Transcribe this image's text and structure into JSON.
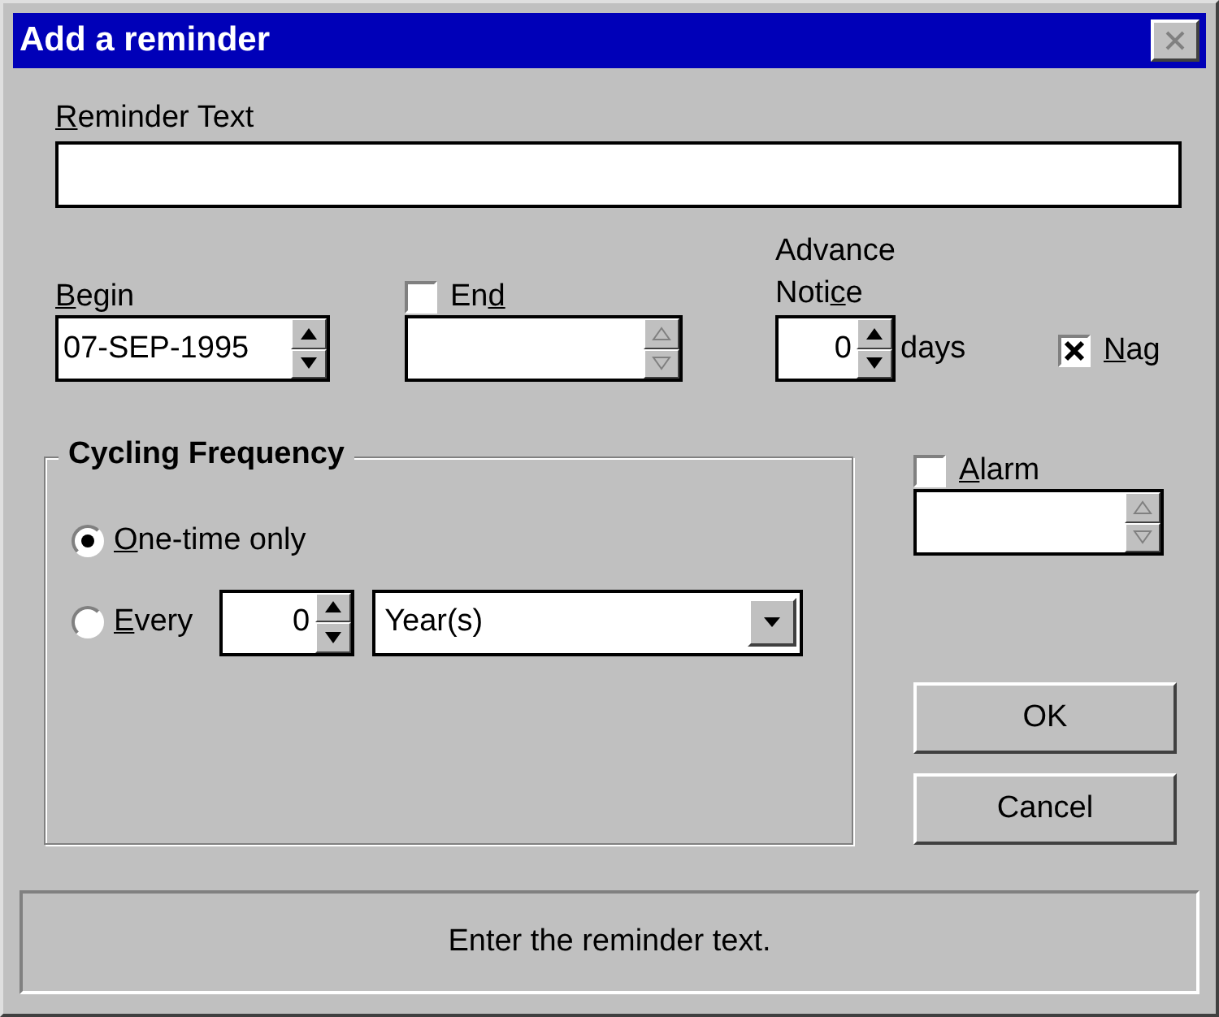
{
  "window": {
    "title": "Add a reminder"
  },
  "reminder_text": {
    "label": {
      "key": "R",
      "rest": "eminder Text"
    }
  },
  "begin": {
    "label": {
      "key": "B",
      "rest": "egin"
    },
    "value": "07-SEP-1995",
    "disabled": false
  },
  "end": {
    "label": {
      "lead": "En",
      "key": "d"
    },
    "checked": false,
    "disabled": true
  },
  "advance_notice": {
    "label": {
      "lead": "Advance Noti",
      "key": "c",
      "rest": "e"
    },
    "value": "0",
    "unit": "days",
    "disabled": false
  },
  "nag": {
    "label": {
      "key": "N",
      "rest": "ag"
    },
    "checked": true
  },
  "cycling_frequency": {
    "title": "Cycling Frequency",
    "options": [
      {
        "label": {
          "key": "O",
          "rest": "ne-time only"
        },
        "selected": true
      },
      {
        "label": {
          "key": "E",
          "rest": "very"
        },
        "selected": false
      }
    ],
    "every_count": "0",
    "every_unit": "Year(s)"
  },
  "alarm": {
    "label": {
      "key": "A",
      "rest": "larm"
    },
    "checked": false,
    "disabled": true
  },
  "buttons": [
    "OK",
    "Cancel"
  ],
  "status_bar": "Enter the reminder text."
}
